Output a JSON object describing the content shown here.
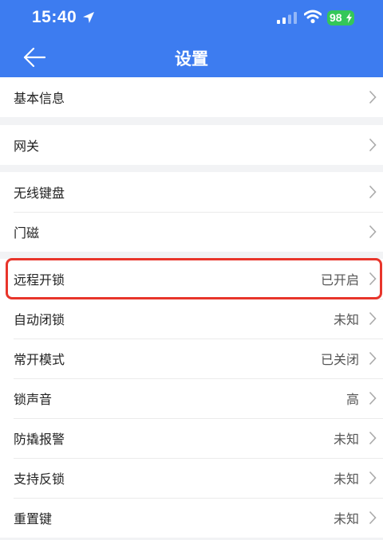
{
  "status_bar": {
    "time": "15:40",
    "battery": "98"
  },
  "nav": {
    "title": "设置"
  },
  "groups": [
    {
      "rows": [
        {
          "label": "基本信息",
          "value": ""
        }
      ]
    },
    {
      "rows": [
        {
          "label": "网关",
          "value": ""
        }
      ]
    },
    {
      "rows": [
        {
          "label": "无线键盘",
          "value": ""
        },
        {
          "label": "门磁",
          "value": ""
        }
      ]
    },
    {
      "rows": [
        {
          "label": "远程开锁",
          "value": "已开启"
        },
        {
          "label": "自动闭锁",
          "value": "未知"
        },
        {
          "label": "常开模式",
          "value": "已关闭"
        },
        {
          "label": "锁声音",
          "value": "高"
        },
        {
          "label": "防撬报警",
          "value": "未知"
        },
        {
          "label": "支持反锁",
          "value": "未知"
        },
        {
          "label": "重置键",
          "value": "未知"
        }
      ]
    }
  ],
  "colors": {
    "header": "#3d7cf0",
    "highlight": "#e8352b"
  }
}
